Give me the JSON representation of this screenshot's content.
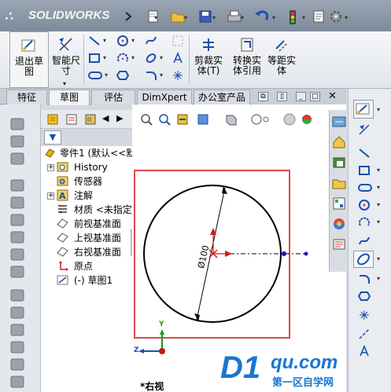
{
  "app": {
    "logo_text": "SOLIDWORKS",
    "logo_mark": "3S"
  },
  "quick_access": [
    "new-icon",
    "open-icon",
    "save-icon",
    "print-icon",
    "undo-icon",
    "rebuild-icon",
    "options-icon"
  ],
  "ribbon": {
    "exit_sketch": "退出草\n图",
    "smart_dimension": "智能尺\n寸",
    "trim": "剪裁实\n体(T)",
    "convert": "转换实\n体引用",
    "offset": "等距实\n体"
  },
  "tabs": [
    "特征",
    "草图",
    "评估",
    "DimXpert",
    "办公室产品"
  ],
  "active_tab": "草图",
  "tree": {
    "root": "零件1 (默认<<默",
    "items": [
      "History",
      "传感器",
      "注解",
      "材质 <未指定",
      "前视基准面",
      "上视基准面",
      "右视基准面",
      "原点",
      "(-) 草图1"
    ]
  },
  "filter_glyph": "▼",
  "sketch": {
    "dimension": "Ø100",
    "axis_x": "Z",
    "axis_y": "Y"
  },
  "view_label": "*右视",
  "watermark": {
    "big": "D1",
    "small": "qu.com",
    "cn": "第一区自学网"
  },
  "colors": {
    "highlight_box": "#e04848",
    "origin": "#d11b1b",
    "sketch_point": "#1414c8",
    "accent": "#1976d2"
  }
}
